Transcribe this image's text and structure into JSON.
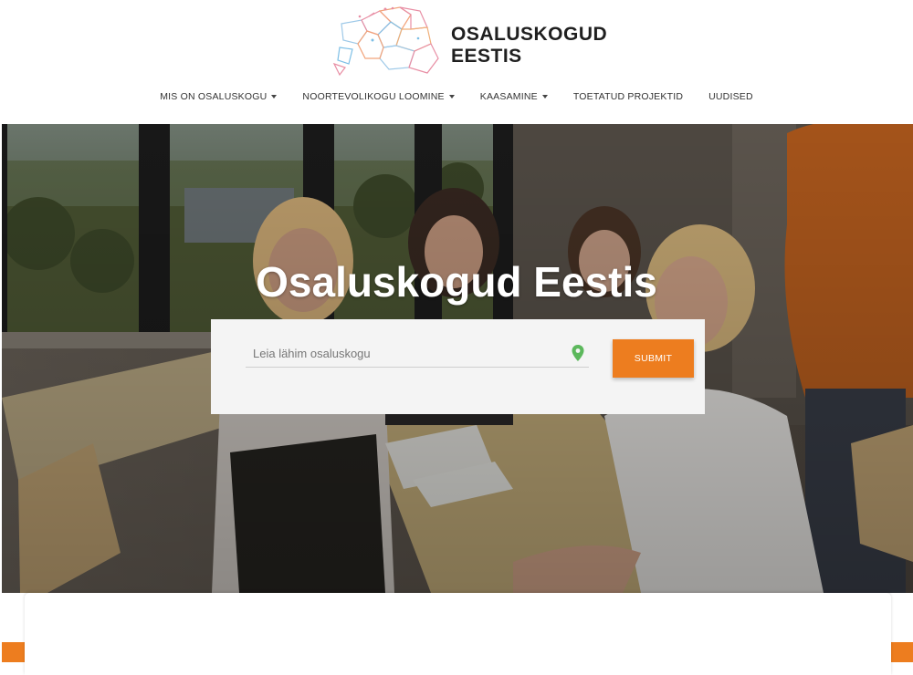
{
  "logo": {
    "line1": "OSALUSKOGUD",
    "line2": "EESTIS"
  },
  "nav": {
    "items": [
      {
        "label": "MIS ON OSALUSKOGU",
        "has_dropdown": true
      },
      {
        "label": "NOORTEVOLIKOGU LOOMINE",
        "has_dropdown": true
      },
      {
        "label": "KAASAMINE",
        "has_dropdown": true
      },
      {
        "label": "TOETATUD PROJEKTID",
        "has_dropdown": false
      },
      {
        "label": "UUDISED",
        "has_dropdown": false
      }
    ]
  },
  "hero": {
    "title": "Osaluskogud Eestis"
  },
  "search": {
    "placeholder": "Leia lähim osaluskogu",
    "value": "",
    "submit_label": "SUBMIT"
  },
  "colors": {
    "accent": "#ed7d1f",
    "pin": "#5cb85c",
    "text_dark": "#1f1f1f"
  },
  "icons": {
    "location": "map-pin-icon",
    "dropdown": "caret-down-icon"
  }
}
